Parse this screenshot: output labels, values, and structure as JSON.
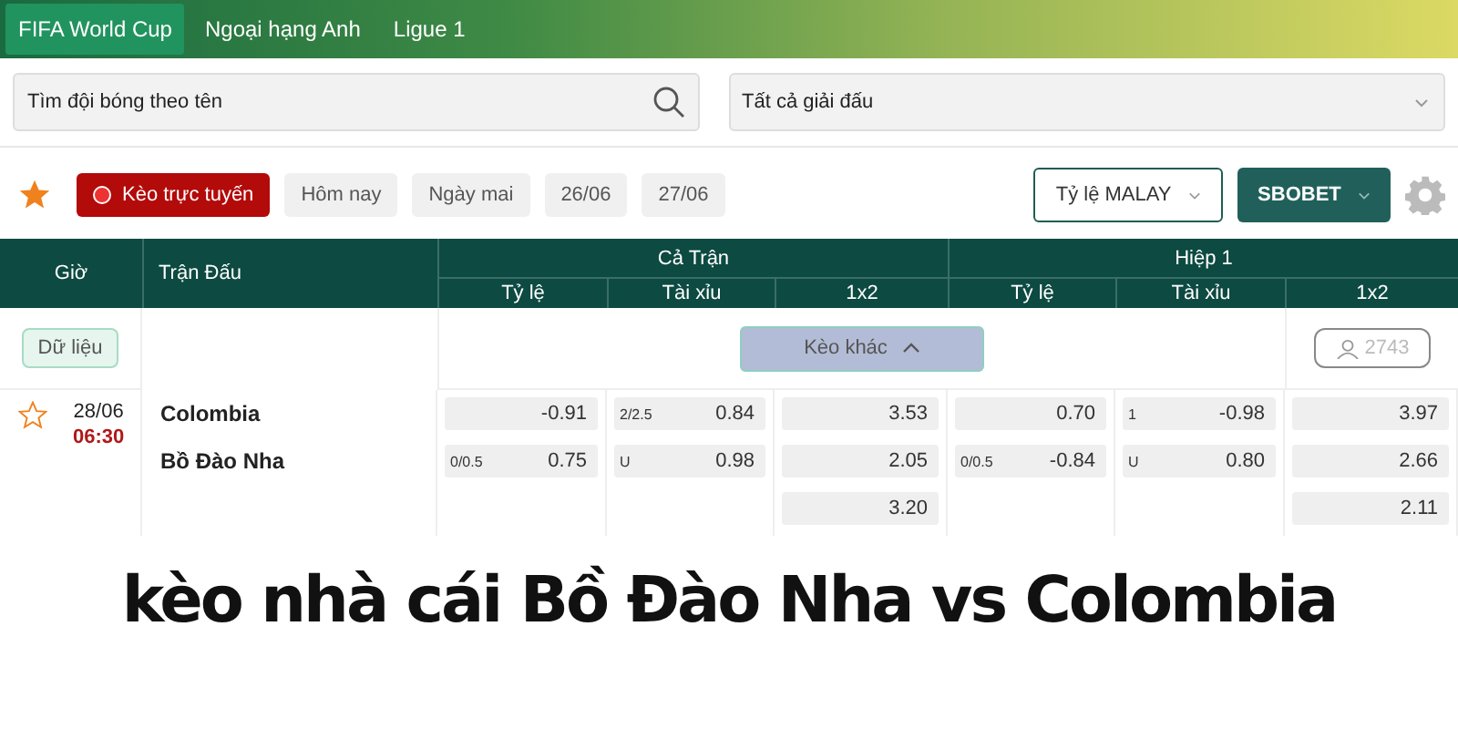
{
  "tabs": [
    {
      "label": "FIFA World Cup",
      "selected": true
    },
    {
      "label": "Ngoại hạng Anh",
      "selected": false
    },
    {
      "label": "Ligue 1",
      "selected": false
    }
  ],
  "search": {
    "placeholder": "Tìm đội bóng theo tên"
  },
  "league_select": {
    "value": "Tất cả giải đấu"
  },
  "filters": [
    {
      "label": "Kèo trực tuyến",
      "kind": "live",
      "selected": true
    },
    {
      "label": "Hôm nay",
      "kind": "date",
      "selected": false
    },
    {
      "label": "Ngày mai",
      "kind": "date",
      "selected": false
    },
    {
      "label": "26/06",
      "kind": "date",
      "selected": false
    },
    {
      "label": "27/06",
      "kind": "date",
      "selected": false
    }
  ],
  "odds_format": {
    "value": "Tỷ lệ MALAY"
  },
  "bookmaker": {
    "value": "SBOBET"
  },
  "table": {
    "columns": [
      "Giờ",
      "Trận Đấu"
    ],
    "groups": [
      {
        "title": "Cả Trận",
        "columns": [
          "Tỷ lệ",
          "Tài xỉu",
          "1x2"
        ]
      },
      {
        "title": "Hiệp 1",
        "columns": [
          "Tỷ lệ",
          "Tài xỉu",
          "1x2"
        ]
      }
    ],
    "data_button": "Dữ liệu",
    "more_button": "Kèo khác",
    "viewers": "2743",
    "matches": [
      {
        "date": "28/06",
        "time": "06:30",
        "favorite": false,
        "home": "Colombia",
        "away": "Bồ Đào Nha",
        "odds": [
          [
            {
              "value": "-0.91"
            },
            {
              "label": "0/0.5",
              "value": "0.75"
            }
          ],
          [
            {
              "label": "2/2.5",
              "value": "0.84"
            },
            {
              "label": "U",
              "value": "0.98"
            }
          ],
          [
            {
              "value": "3.53"
            },
            {
              "value": "2.05"
            },
            {
              "value": "3.20"
            }
          ],
          [
            {
              "value": "0.70"
            },
            {
              "label": "0/0.5",
              "value": "-0.84"
            }
          ],
          [
            {
              "label": "1",
              "value": "-0.98"
            },
            {
              "label": "U",
              "value": "0.80"
            }
          ],
          [
            {
              "value": "3.97"
            },
            {
              "value": "2.66"
            },
            {
              "value": "2.11"
            }
          ]
        ]
      }
    ]
  },
  "caption": "kèo nhà cái Bồ Đào Nha vs Colombia"
}
